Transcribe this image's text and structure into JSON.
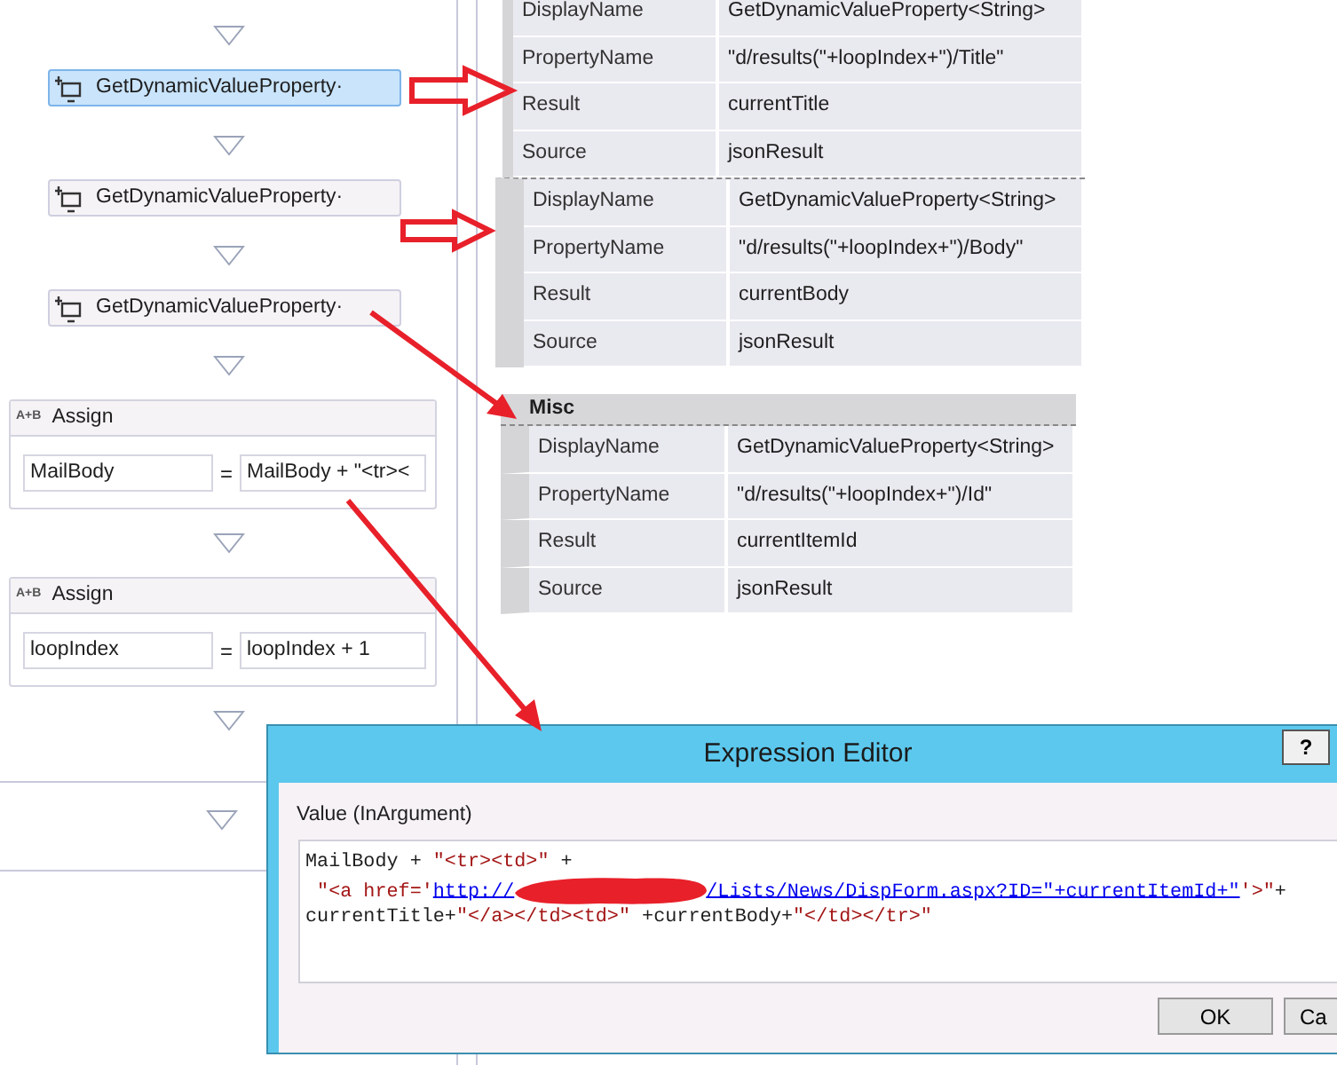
{
  "workflow": {
    "activities": [
      {
        "kind": "activity",
        "label": "GetDynamicValueProperty·",
        "selected": true
      },
      {
        "kind": "activity",
        "label": "GetDynamicValueProperty·",
        "selected": false
      },
      {
        "kind": "activity",
        "label": "GetDynamicValueProperty·",
        "selected": false
      },
      {
        "kind": "assign",
        "icon_text": "A+B",
        "title": "Assign",
        "to": "MailBody",
        "equals": "=",
        "value": "MailBody + \"<tr><"
      },
      {
        "kind": "assign",
        "icon_text": "A+B",
        "title": "Assign",
        "to": "loopIndex",
        "equals": "=",
        "value": "loopIndex + 1"
      }
    ]
  },
  "property_grids": [
    {
      "rows": [
        {
          "name": "DisplayName",
          "value": "GetDynamicValueProperty<String>"
        },
        {
          "name": "PropertyName",
          "value": "\"d/results(\"+loopIndex+\")/Title\""
        },
        {
          "name": "Result",
          "value": "currentTitle"
        },
        {
          "name": "Source",
          "value": "jsonResult"
        }
      ]
    },
    {
      "rows": [
        {
          "name": "DisplayName",
          "value": "GetDynamicValueProperty<String>"
        },
        {
          "name": "PropertyName",
          "value": "\"d/results(\"+loopIndex+\")/Body\""
        },
        {
          "name": "Result",
          "value": "currentBody"
        },
        {
          "name": "Source",
          "value": "jsonResult"
        }
      ]
    },
    {
      "header": "Misc",
      "rows": [
        {
          "name": "DisplayName",
          "value": "GetDynamicValueProperty<String>"
        },
        {
          "name": "PropertyName",
          "value": "\"d/results(\"+loopIndex+\")/Id\""
        },
        {
          "name": "Result",
          "value": "currentItemId"
        },
        {
          "name": "Source",
          "value": "jsonResult"
        }
      ]
    }
  ],
  "expression_editor": {
    "title": "Expression Editor",
    "help_button": "?",
    "label": "Value (InArgument)",
    "code_lines": [
      [
        {
          "kind": "plain",
          "text": "MailBody + "
        },
        {
          "kind": "string",
          "text": "\"<tr><td>\""
        },
        {
          "kind": "plain",
          "text": " +"
        }
      ],
      [
        {
          "kind": "string",
          "text": " \"<a href='"
        },
        {
          "kind": "link",
          "text": "http://"
        },
        {
          "kind": "redacted"
        },
        {
          "kind": "link",
          "text": "/Lists/News/DispForm.aspx?ID=\"+currentItemId+\""
        },
        {
          "kind": "string",
          "text": "'>\""
        },
        {
          "kind": "plain",
          "text": "+"
        }
      ],
      [
        {
          "kind": "plain",
          "text": "currentTitle+"
        },
        {
          "kind": "string",
          "text": "\"</a></td><td>\""
        },
        {
          "kind": "plain",
          "text": " +currentBody+"
        },
        {
          "kind": "string",
          "text": "\"</td></tr>\""
        }
      ]
    ],
    "buttons": [
      "OK",
      "Ca"
    ]
  }
}
